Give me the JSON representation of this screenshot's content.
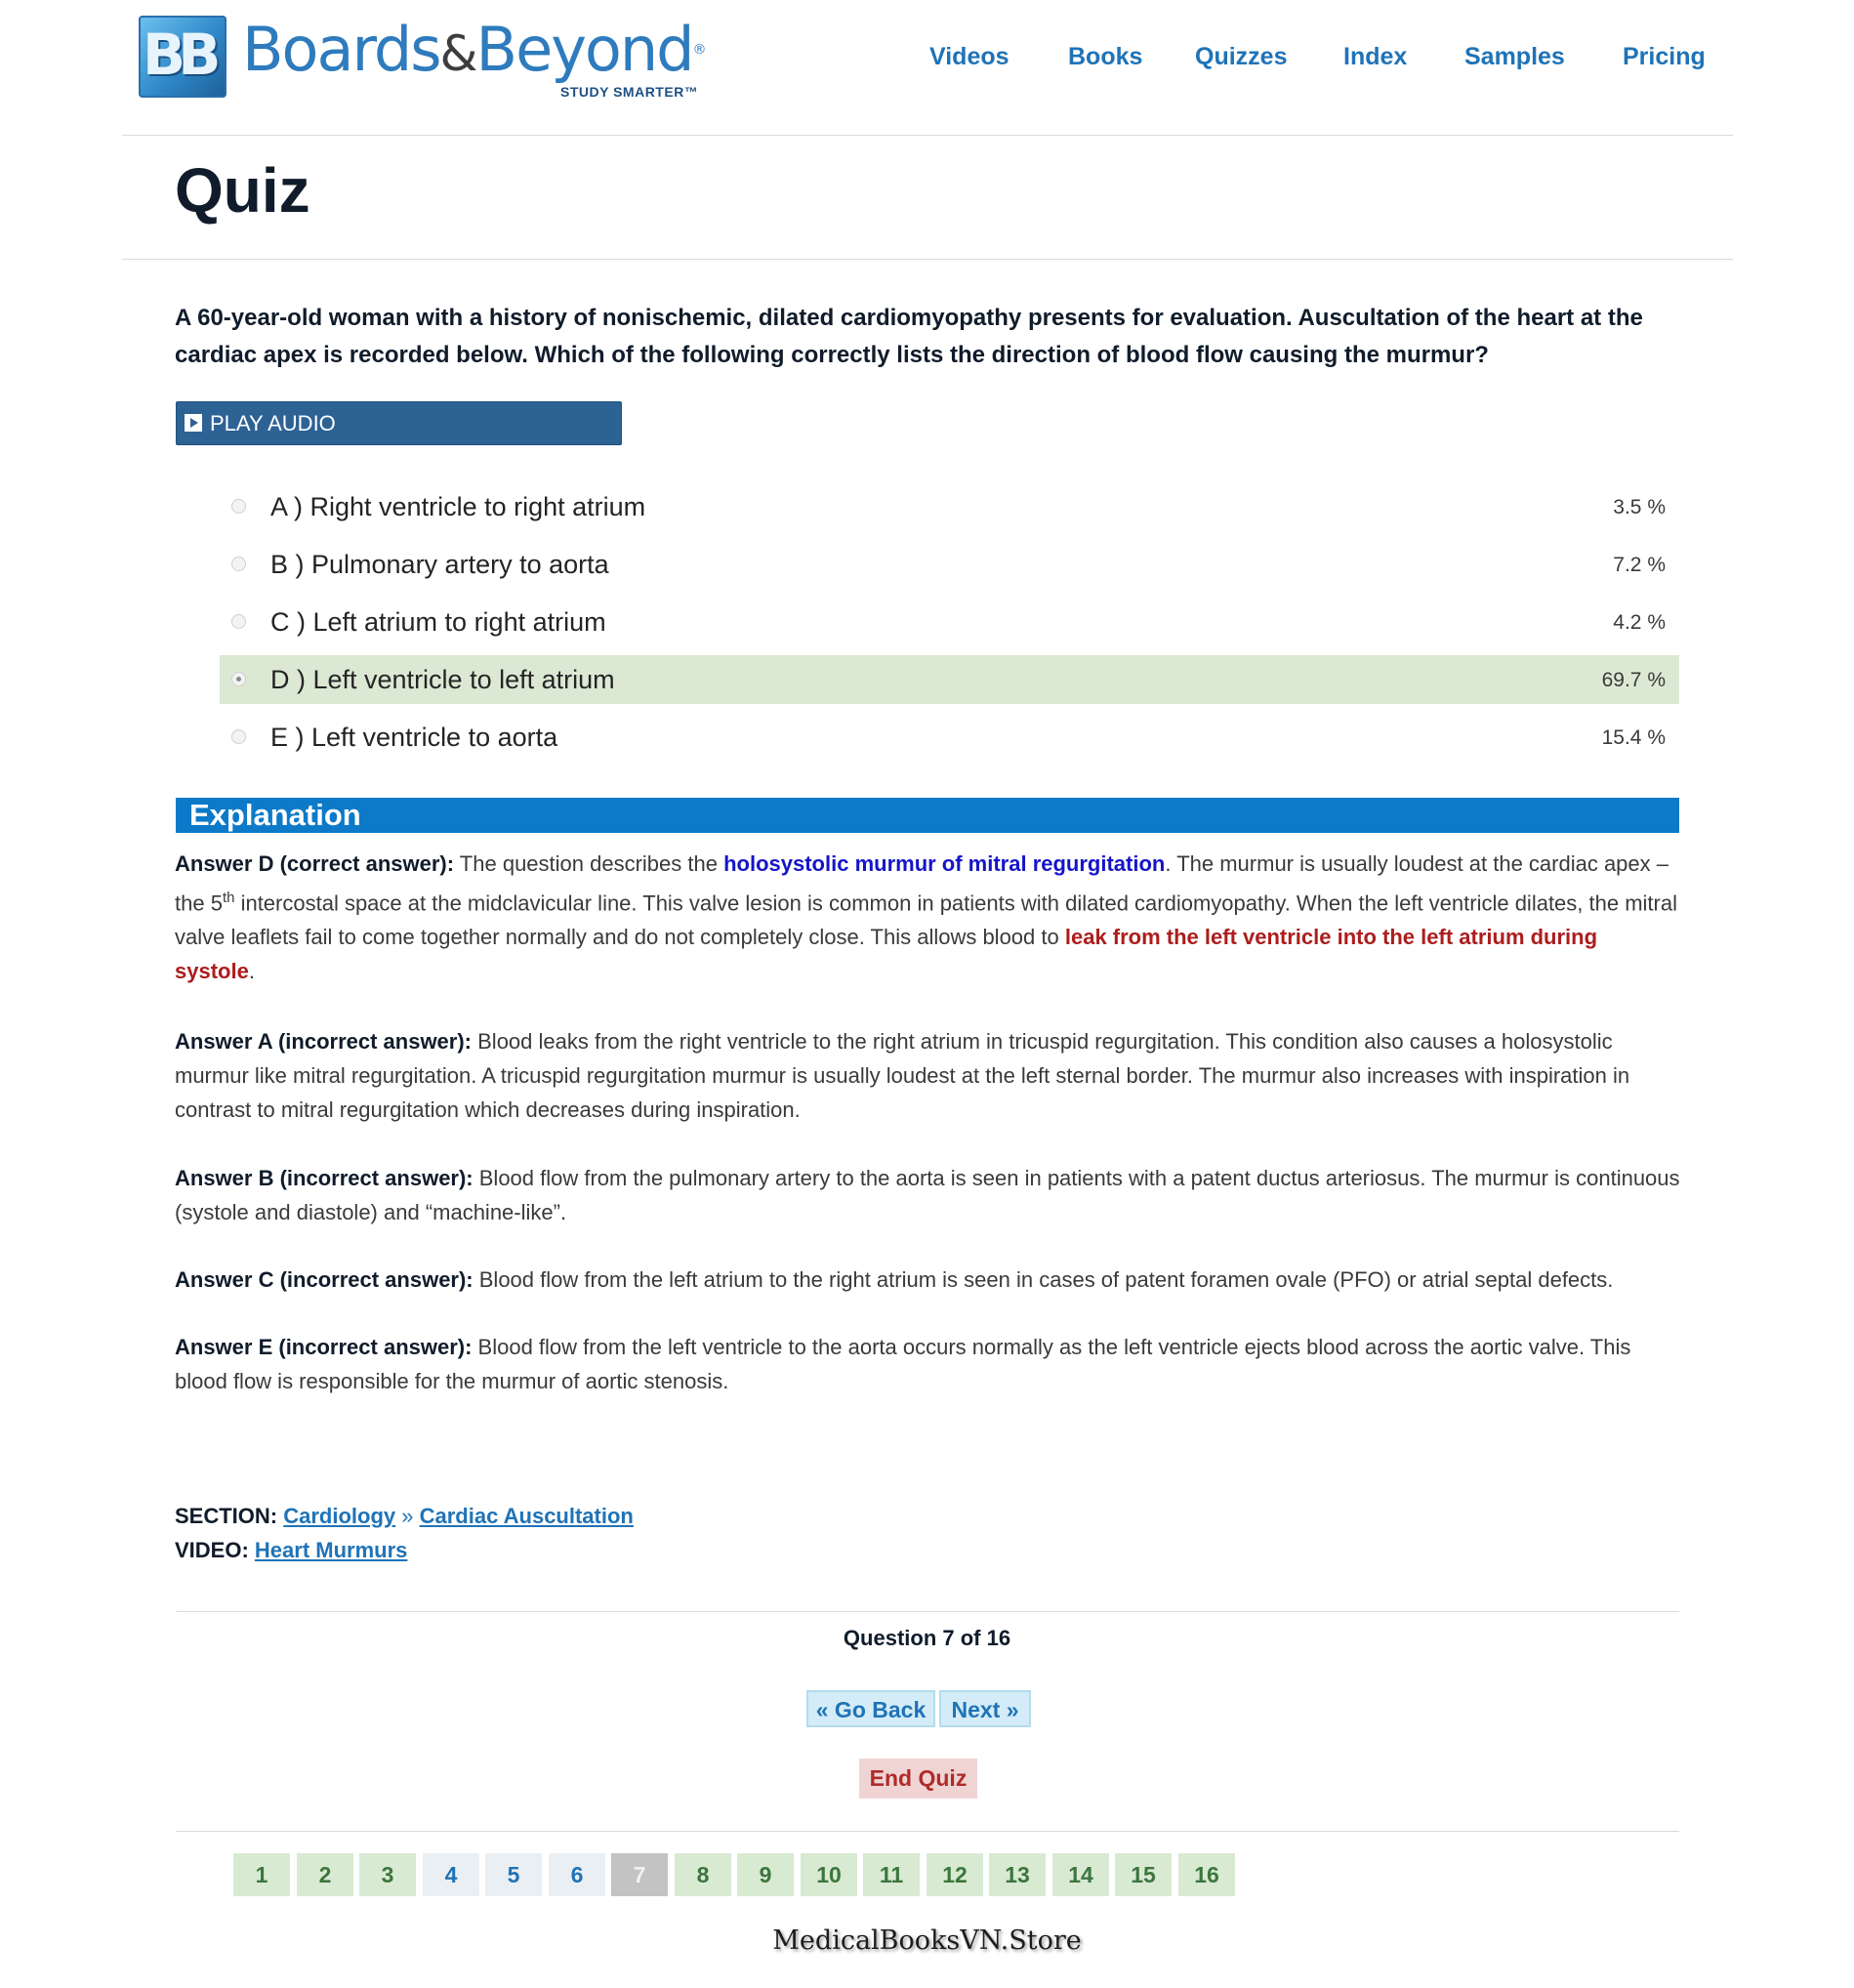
{
  "brand": {
    "logo_mark": "BB",
    "name_part1": "Boards",
    "name_amp": "&",
    "name_part2": "Beyond",
    "registered": "®",
    "tagline": "STUDY SMARTER™"
  },
  "nav": {
    "items": [
      "Videos",
      "Books",
      "Quizzes",
      "Index",
      "Samples",
      "Pricing"
    ]
  },
  "page_title": "Quiz",
  "question": {
    "text": "A 60-year-old woman with a history of nonischemic, dilated cardiomyopathy presents for evaluation. Auscultation of the heart at the cardiac apex is recorded below. Which of the following correctly lists the direction of blood flow causing the murmur?",
    "audio_label": "PLAY AUDIO"
  },
  "options": [
    {
      "label": "A ) Right ventricle to right atrium",
      "pct": "3.5 %"
    },
    {
      "label": "B ) Pulmonary artery to aorta",
      "pct": "7.2 %"
    },
    {
      "label": "C ) Left atrium to right atrium",
      "pct": "4.2 %"
    },
    {
      "label": "D ) Left ventricle to left atrium",
      "pct": "69.7 %",
      "selected": true
    },
    {
      "label": "E ) Left ventricle to aorta",
      "pct": "15.4 %"
    }
  ],
  "explanation": {
    "heading": "Explanation",
    "d": {
      "lead": "Answer D (correct answer):",
      "t1": " The question describes the ",
      "h1": "holosystolic murmur of mitral regurgitation",
      "t2": ". The murmur is usually loudest at the cardiac apex – the 5",
      "sup": "th",
      "t3": " intercostal space at the midclavicular line. This valve lesion is common in patients with dilated cardiomyopathy. When the left ventricle dilates, the mitral valve leaflets fail to come together normally and do not completely close. This allows blood to ",
      "h2": "leak from the left ventricle into the left atrium during systole",
      "t4": "."
    },
    "a": {
      "lead": "Answer A (incorrect answer):",
      "text": " Blood leaks from the right ventricle to the right atrium in tricuspid regurgitation. This condition also causes a holosystolic murmur like mitral regurgitation. A tricuspid regurgitation murmur is usually loudest at the left sternal border. The murmur also increases with inspiration in contrast to mitral regurgitation which decreases during inspiration."
    },
    "b": {
      "lead": "Answer B (incorrect answer):",
      "text": " Blood flow from the pulmonary artery to the aorta is seen in patients with a patent ductus arteriosus. The murmur is continuous (systole and diastole) and “machine-like”."
    },
    "c": {
      "lead": "Answer C (incorrect answer):",
      "text": " Blood flow from the left atrium to the right atrium is seen in cases of patent foramen ovale (PFO) or atrial septal defects."
    },
    "e": {
      "lead": "Answer E (incorrect answer):",
      "text": " Blood flow from the left ventricle to the aorta occurs normally as the left ventricle ejects blood across the aortic valve. This blood flow is responsible for the murmur of aortic stenosis."
    }
  },
  "meta": {
    "section_label": "SECTION:",
    "section_link1": "Cardiology",
    "section_sep": " » ",
    "section_link2": "Cardiac Auscultation",
    "video_label": "VIDEO:",
    "video_link": "Heart Murmurs"
  },
  "navigation": {
    "counter": "Question 7 of 16",
    "back": "« Go Back",
    "next": "Next »",
    "end": "End Quiz"
  },
  "pager": {
    "pages": [
      "1",
      "2",
      "3",
      "4",
      "5",
      "6",
      "7",
      "8",
      "9",
      "10",
      "11",
      "12",
      "13",
      "14",
      "15",
      "16"
    ],
    "current": "7",
    "states": [
      "green",
      "green",
      "green",
      "blue",
      "blue",
      "blue",
      "current",
      "green",
      "green",
      "green",
      "green",
      "green",
      "green",
      "green",
      "green",
      "green"
    ]
  },
  "watermark": "MedicalBooksVN.Store",
  "colors": {
    "brand_blue": "#2e7bbd",
    "nav_link": "#1f73b7",
    "explanation_bar": "#0c7ac8",
    "audio_button": "#2d6295",
    "selected_option_bg": "#dbe9d4",
    "highlight_blue": "#1515c8",
    "highlight_red": "#ad1d1d",
    "end_quiz_bg": "#f0d4d4"
  }
}
